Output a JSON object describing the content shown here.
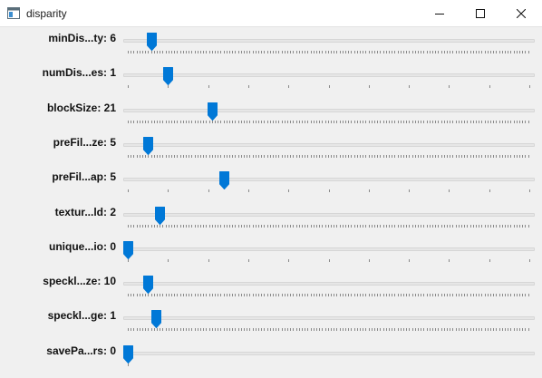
{
  "window": {
    "title": "disparity",
    "accent_color": "#0078d7",
    "icons": {
      "app": "app-window-icon",
      "minimize": "minimize-icon",
      "maximize": "maximize-icon",
      "close": "close-icon"
    }
  },
  "trackbars": [
    {
      "label": "minDis...ty: 6",
      "value": 6,
      "fraction": 0.06,
      "tick_style": "dense"
    },
    {
      "label": "numDis...es: 1",
      "value": 1,
      "fraction": 0.1,
      "tick_style": "sparse"
    },
    {
      "label": "blockSize: 21",
      "value": 21,
      "fraction": 0.21,
      "tick_style": "dense"
    },
    {
      "label": "preFil...ze: 5",
      "value": 5,
      "fraction": 0.05,
      "tick_style": "dense"
    },
    {
      "label": "preFil...ap: 5",
      "value": 5,
      "fraction": 0.24,
      "tick_style": "sparse"
    },
    {
      "label": "textur...ld: 2",
      "value": 2,
      "fraction": 0.08,
      "tick_style": "dense"
    },
    {
      "label": "unique...io: 0",
      "value": 0,
      "fraction": 0.0,
      "tick_style": "sparse"
    },
    {
      "label": "speckl...ze: 10",
      "value": 10,
      "fraction": 0.05,
      "tick_style": "dense"
    },
    {
      "label": "speckl...ge: 1",
      "value": 1,
      "fraction": 0.07,
      "tick_style": "dense"
    },
    {
      "label": "savePa...rs: 0",
      "value": 0,
      "fraction": 0.0,
      "tick_style": "single"
    }
  ]
}
